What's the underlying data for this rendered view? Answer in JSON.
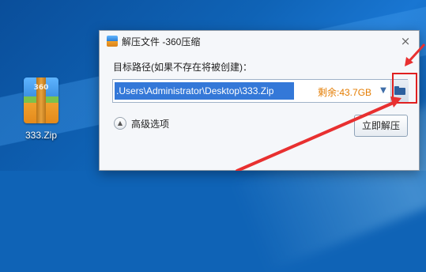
{
  "desktop": {
    "icon_label": "333.Zip",
    "icon_number": "360",
    "icon_name": "zip-archive-icon"
  },
  "dialog": {
    "title": "解压文件 -360压缩",
    "close_symbol": "×",
    "path_label": "目标路径(如果不存在将被创建)：",
    "path_value": ".Users\\Administrator\\Desktop\\333.Zip",
    "free_space": "剩余:43.7GB",
    "dropdown_symbol": "▼",
    "advanced_symbol": "▲",
    "advanced_label": "高级选项",
    "extract_button": "立即解压"
  },
  "colors": {
    "selection": "#3478d8",
    "free_space": "#e47c00",
    "annotation": "#e02020"
  }
}
